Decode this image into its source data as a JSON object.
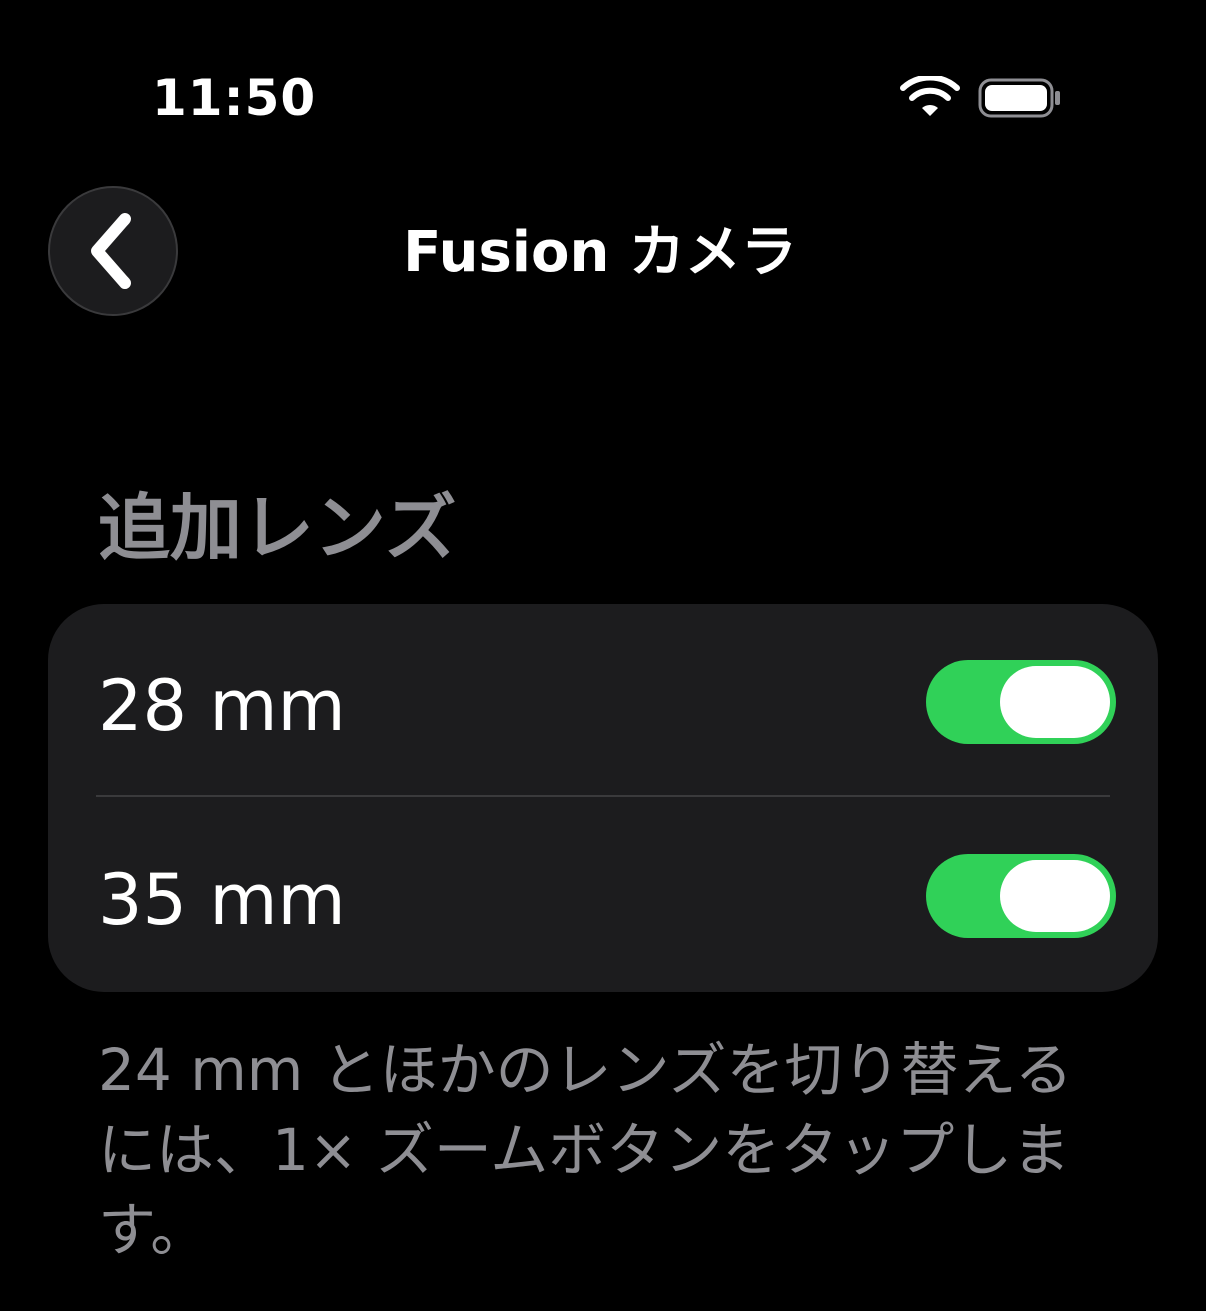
{
  "status_bar": {
    "time": "11:50",
    "wifi_icon": "wifi-icon",
    "battery_icon": "battery-icon"
  },
  "nav": {
    "back_icon": "chevron-left-icon",
    "title": "Fusion カメラ"
  },
  "section": {
    "header": "追加レンズ",
    "rows": [
      {
        "label": "28 mm",
        "toggle_on": true
      },
      {
        "label": "35 mm",
        "toggle_on": true
      }
    ]
  },
  "footer": {
    "text": "24 mm とほかのレンズを切り替えるには、1× ズームボタンをタップします。"
  },
  "colors": {
    "background": "#000000",
    "card": "#1c1c1e",
    "toggle_on": "#30d158",
    "secondary_text": "#8e8e93"
  }
}
